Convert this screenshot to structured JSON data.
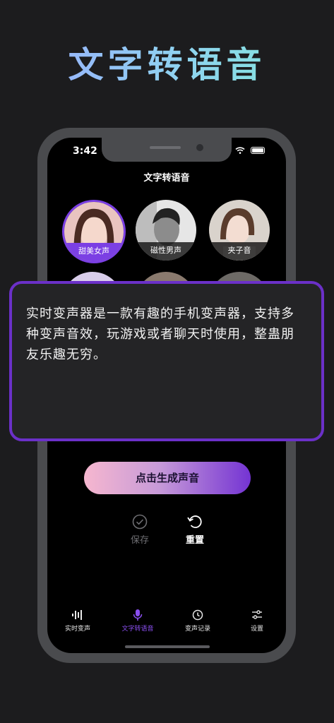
{
  "headline": "文字转语音",
  "phone": {
    "status_time": "3:42",
    "screen_title": "文字转语音",
    "voices": [
      {
        "label": "甜美女声",
        "selected": true
      },
      {
        "label": "磁性男声",
        "selected": false
      },
      {
        "label": "夹子音",
        "selected": false
      }
    ],
    "input_text": "实时变声器是一款有趣的手机变声器，支持多种变声音效，玩游戏或者聊天时使用，整蛊朋友乐趣无穷。",
    "generate_button": "点击生成声音",
    "actions": {
      "save_label": "保存",
      "reset_label": "重置"
    },
    "tabs": [
      {
        "label": "实时变声",
        "icon": "waveform-icon",
        "active": false
      },
      {
        "label": "文字转语音",
        "icon": "microphone-icon",
        "active": true
      },
      {
        "label": "变声记录",
        "icon": "clock-icon",
        "active": false
      },
      {
        "label": "设置",
        "icon": "sliders-icon",
        "active": false
      }
    ]
  },
  "colors": {
    "accent": "#7b3fe4",
    "card_border": "#6b30c8",
    "background": "#1c1c1e"
  }
}
